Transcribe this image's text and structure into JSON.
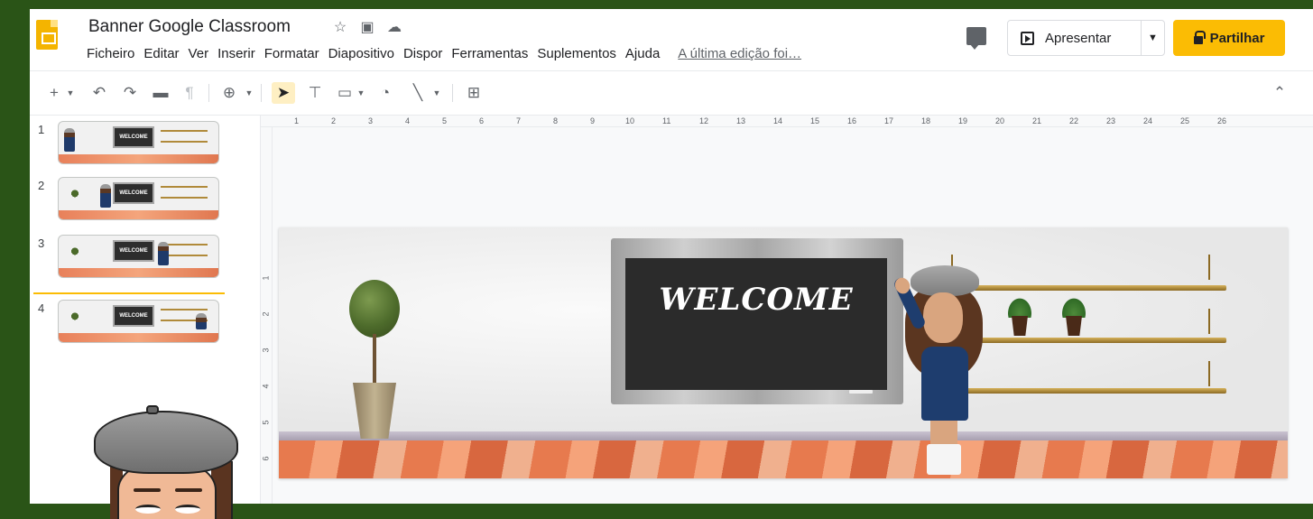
{
  "header": {
    "doc_title": "Banner Google Classroom",
    "menu": [
      "Ficheiro",
      "Editar",
      "Ver",
      "Inserir",
      "Formatar",
      "Diapositivo",
      "Dispor",
      "Ferramentas",
      "Suplementos",
      "Ajuda"
    ],
    "last_edit": "A última edição foi…",
    "present_label": "Apresentar",
    "share_label": "Partilhar"
  },
  "toolbar": {
    "icons": [
      "add-icon",
      "undo-icon",
      "redo-icon",
      "print-icon",
      "paint-format-icon",
      "zoom-icon",
      "select-icon",
      "text-box-icon",
      "image-icon",
      "shape-icon",
      "line-icon",
      "comment-add-icon",
      "collapse-icon"
    ]
  },
  "filmstrip": {
    "slides": [
      {
        "number": "1",
        "thumb_text": "WELCOME"
      },
      {
        "number": "2",
        "thumb_text": "WELCOME"
      },
      {
        "number": "3",
        "thumb_text": "WELCOME"
      },
      {
        "number": "4",
        "thumb_text": "WELCOME"
      }
    ],
    "selected_slide": 4
  },
  "ruler": {
    "horizontal": [
      "1",
      "2",
      "3",
      "4",
      "5",
      "6",
      "7",
      "8",
      "9",
      "10",
      "11",
      "12",
      "13",
      "14",
      "15",
      "16",
      "17",
      "18",
      "19",
      "20",
      "21",
      "22",
      "23",
      "24",
      "25",
      "26"
    ],
    "vertical": [
      "1",
      "2",
      "3",
      "4",
      "5",
      "6"
    ]
  },
  "slide": {
    "board_text": "WELCOME"
  },
  "colors": {
    "background": "#2a5417",
    "share_button": "#fbbc04",
    "selection_accent": "#fbbc04"
  }
}
